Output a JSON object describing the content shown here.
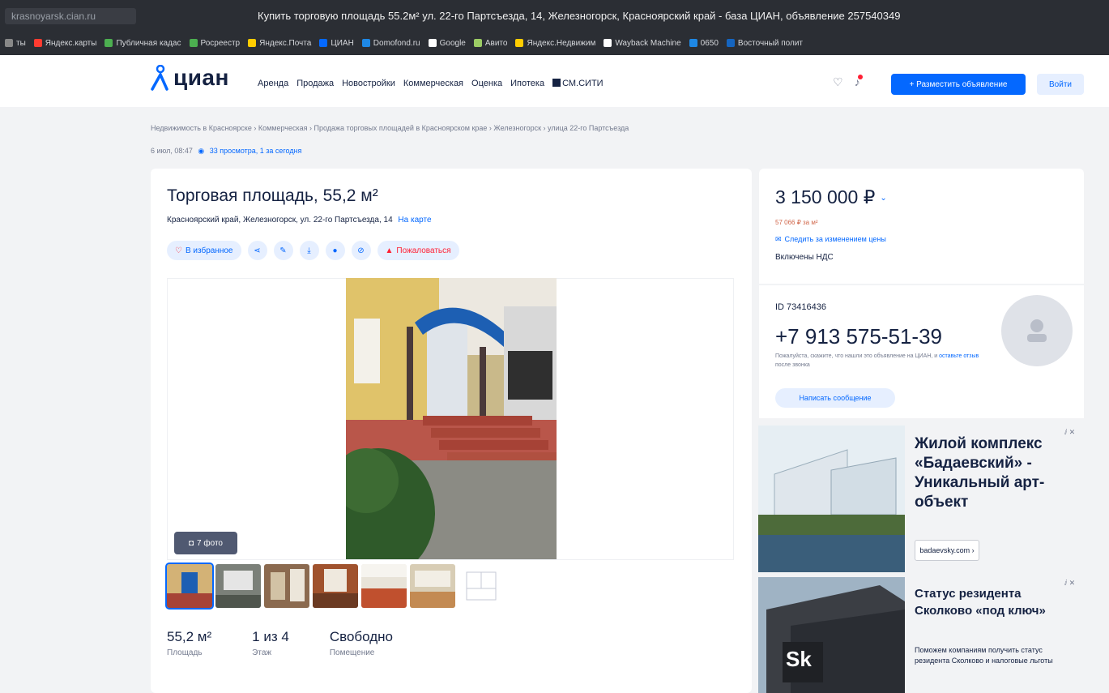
{
  "browser": {
    "address": "krasnoyarsk.cian.ru",
    "window_title": "Купить торговую площадь 55.2м² ул. 22-го Партсъезда, 14, Железногорск, Красноярский край - база ЦИАН, объявление 257540349",
    "bookmarks": [
      "ты",
      "Яндекс.карты",
      "Публичная кадас",
      "Росреестр",
      "Яндекс.Почта",
      "ЦИАН",
      "Domofond.ru",
      "Google",
      "Авито",
      "Яндекс.Недвижим",
      "Wayback Machine",
      "0650",
      "Восточный полит"
    ],
    "bookmark_colors": [
      "#888888",
      "#ff3b30",
      "#4caf50",
      "#4caf50",
      "#ffcc00",
      "#0468ff",
      "#1e88e5",
      "#ffffff",
      "#9ccc65",
      "#ffcc00",
      "#ffffff",
      "#1e88e5",
      "#1565c0"
    ]
  },
  "header": {
    "logo": "циан",
    "nav": [
      "Аренда",
      "Продажа",
      "Новостройки",
      "Коммерческая",
      "Оценка",
      "Ипотека",
      "СМ.СИТИ"
    ],
    "place_ad": "+ Разместить объявление",
    "login": "Войти",
    "accent": "#0468ff"
  },
  "breadcrumbs": "Недвижимость в Красноярске  ›  Коммерческая  ›  Продажа торговых площадей в Красноярском крае  ›  Железногорск  ›  улица 22-го Партсъезда",
  "meta": {
    "date": "6 июл, 08:47",
    "views": "33 просмотра, 1 за сегодня"
  },
  "listing": {
    "title": "Торговая площадь, 55,2 м²",
    "address": "Красноярский край, Железногорск, ул. 22-го Партсъезда, 14",
    "map_link": "На карте",
    "favorite": "В избранное",
    "complain": "Пожаловаться",
    "photo_count": "7 фото",
    "facts": [
      {
        "value": "55,2 м²",
        "label": "Площадь"
      },
      {
        "value": "1 из 4",
        "label": "Этаж"
      },
      {
        "value": "Свободно",
        "label": "Помещение"
      }
    ]
  },
  "price": {
    "value": "3 150 000 ₽",
    "per_meter": "57 066 ₽ за м²",
    "follow": "Следить за изменением цены",
    "vat": "Включены НДС"
  },
  "contact": {
    "id": "ID 73416436",
    "phone": "+7 913 575-51-39",
    "hint_a": "Пожалуйста, скажите, что нашли это объявление на ЦИАН, и",
    "hint_link": "оставьте отзыв",
    "hint_b": "после звонка",
    "message": "Написать сообщение"
  },
  "ads": [
    {
      "title": "Жилой комплекс «Бадаевский» - Уникальный арт-объект",
      "button": "badaevsky.com ›"
    },
    {
      "title": "Статус резидента Сколково «под ключ»",
      "text": "Поможем компаниям получить статус резидента Сколково и налоговые льготы",
      "logo": "Sk"
    }
  ]
}
